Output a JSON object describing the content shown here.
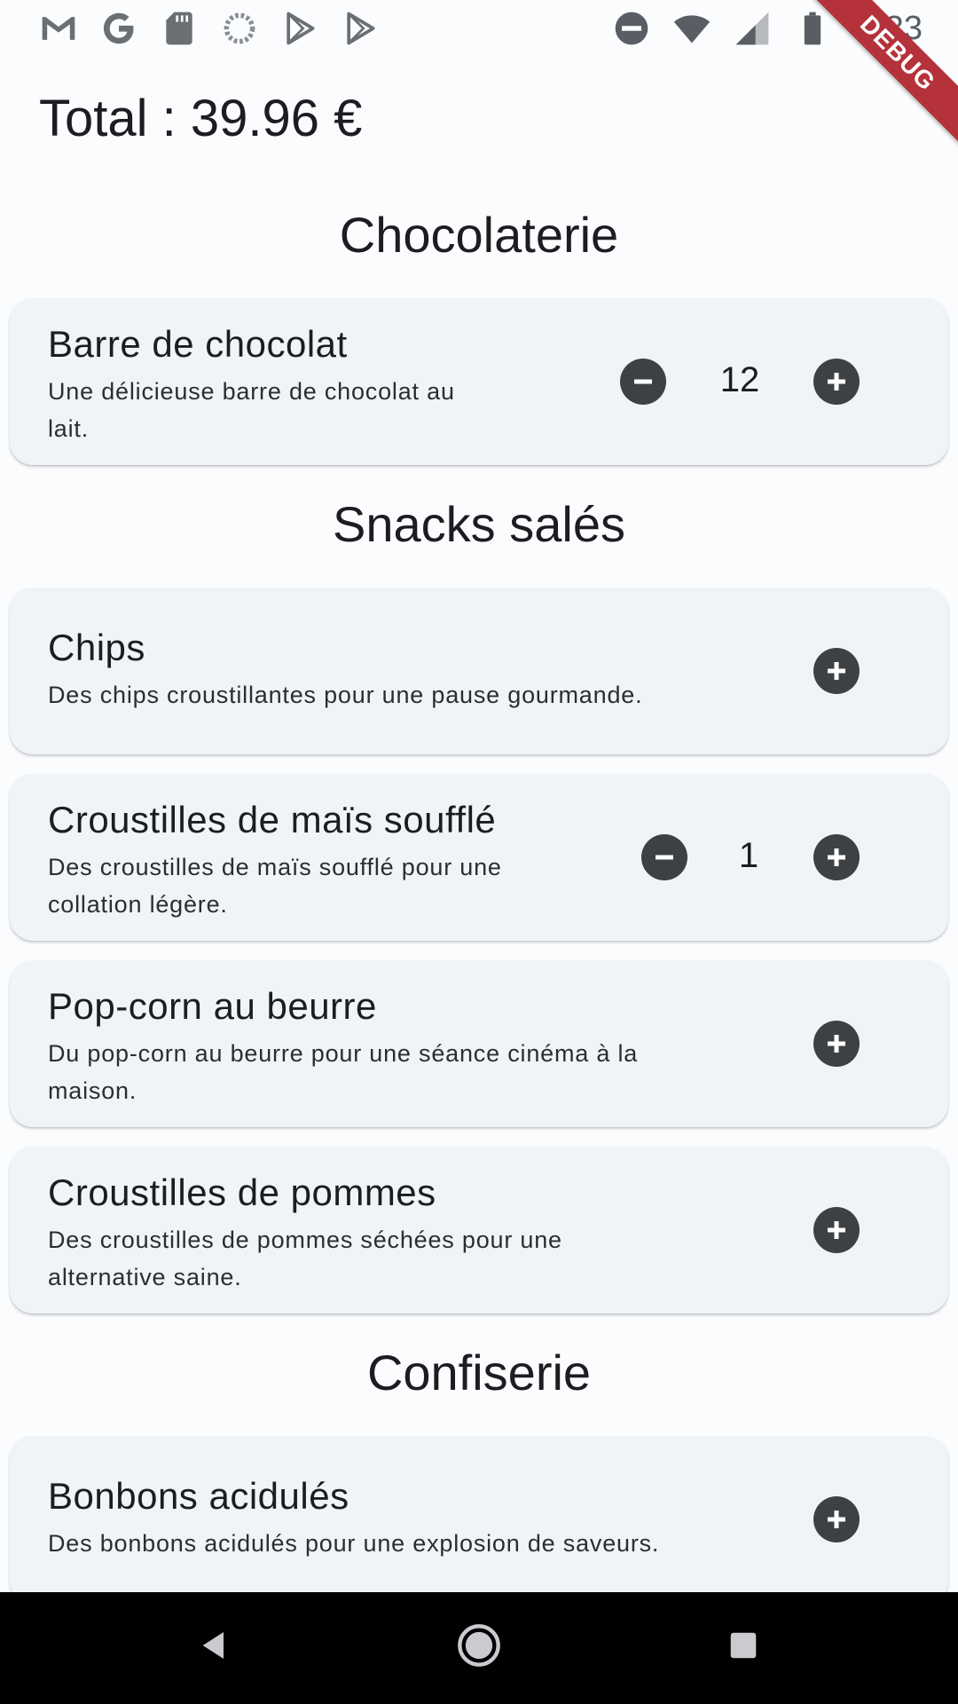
{
  "status_bar": {
    "time": "3:33",
    "left_icons": [
      "gmail-icon",
      "google-icon",
      "sd-card-icon",
      "loading-icon",
      "play-store-icon",
      "play-store-icon"
    ],
    "right_icons": [
      "dnd-icon",
      "wifi-icon",
      "signal-icon",
      "battery-icon"
    ]
  },
  "debug_banner": "DEBUG",
  "total": "Total : 39.96 €",
  "sections": [
    {
      "title": "Chocolaterie",
      "items": [
        {
          "name": "Barre de chocolat",
          "description_line1": "Une délicieuse barre de chocolat au",
          "description_line2": "lait.",
          "quantity": "12"
        }
      ]
    },
    {
      "title": "Snacks salés",
      "items": [
        {
          "name": "Chips",
          "description_line1": "Des chips croustillantes pour une pause gourmande.",
          "description_line2": ""
        },
        {
          "name": "Croustilles de maïs soufflé",
          "description_line1": "Des croustilles de maïs soufflé pour une",
          "description_line2": "collation légère.",
          "quantity": "1"
        },
        {
          "name": "Pop-corn au beurre",
          "description_line1": "Du pop-corn au beurre pour une séance cinéma à la",
          "description_line2": "maison."
        },
        {
          "name": "Croustilles de pommes",
          "description_line1": "Des croustilles de pommes séchées pour une",
          "description_line2": "alternative saine."
        }
      ]
    },
    {
      "title": "Confiserie",
      "items": [
        {
          "name": "Bonbons acidulés",
          "description_line1": "Des bonbons acidulés pour une explosion de saveurs.",
          "description_line2": ""
        }
      ]
    }
  ],
  "colors": {
    "background": "#fbfcfe",
    "card": "#f0f4f8",
    "button": "#3e4144",
    "ribbon": "#b5323a"
  }
}
